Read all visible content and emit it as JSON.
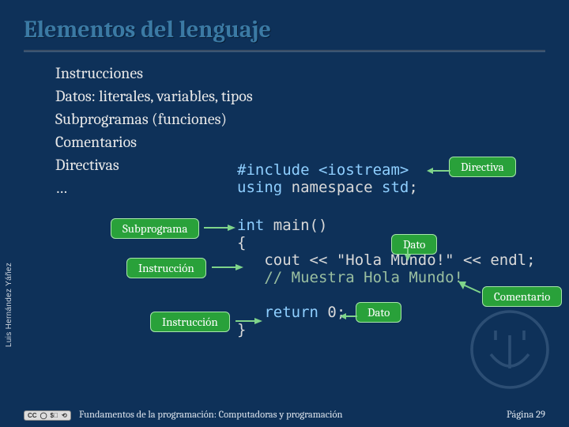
{
  "title": "Elementos del lenguaje",
  "bullets": {
    "b0": "Instrucciones",
    "b1": "Datos: literales, variables, tipos",
    "b2": "Subprogramas (funciones)",
    "b3": "Comentarios",
    "b4": "Directivas",
    "b5": "…"
  },
  "code": {
    "include": "#include <iostream>",
    "using1": "using",
    "using2": " namespace ",
    "using3": "std",
    "using4": ";",
    "int": "int",
    "main": " main()",
    "brace_open": "{",
    "cout": "   cout << ",
    "str": "\"Hola Mundo!\"",
    "endl": " << endl;",
    "comment": "   // Muestra Hola Mundo!",
    "ret": "return",
    "ret2": " 0;",
    "brace_close": "}"
  },
  "labels": {
    "directiva": "Directiva",
    "subprograma": "Subprograma",
    "instruccion": "Instrucción",
    "dato": "Dato",
    "comentario": "Comentario"
  },
  "author": "Luis Hernández Yáñez",
  "footer": {
    "left": "Fundamentos de la programación: Computadoras y programación",
    "right": "Página 29",
    "lic": "CC BY NC SA"
  }
}
